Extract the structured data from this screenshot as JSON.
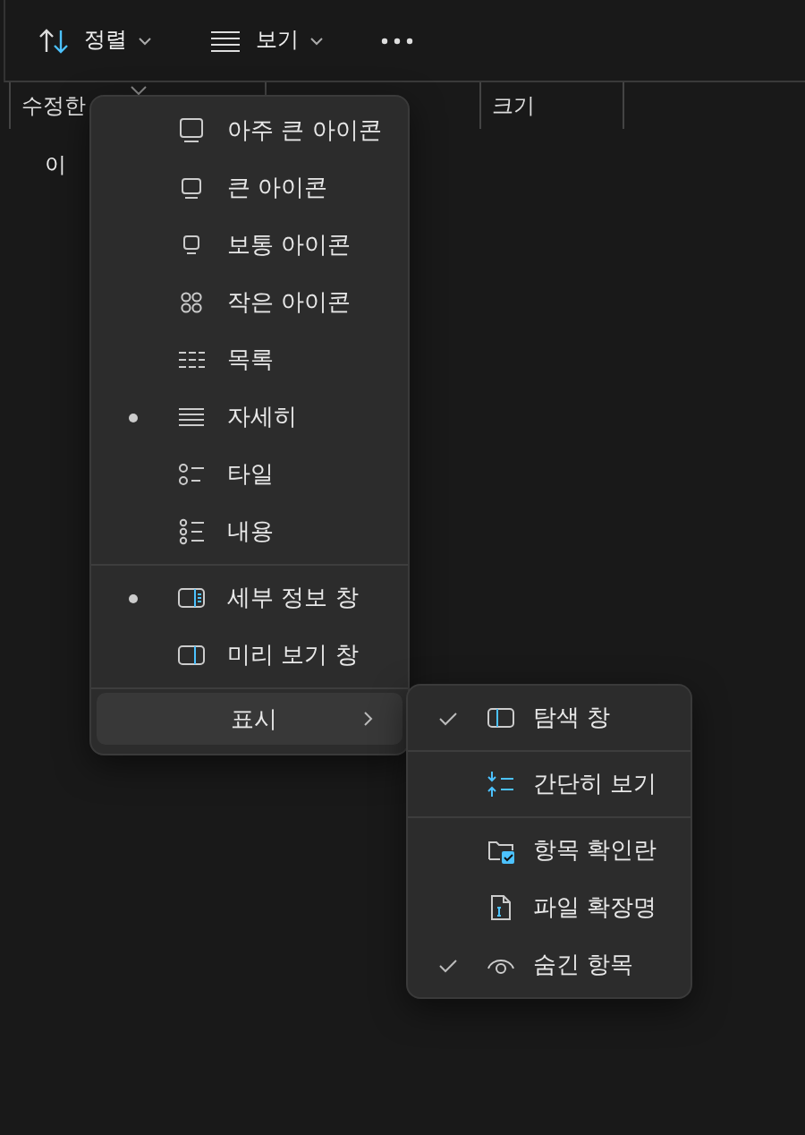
{
  "toolbar": [
    {
      "label": "정렬",
      "kind": "sort"
    },
    {
      "label": "보기",
      "kind": "view"
    },
    {
      "kind": "more"
    }
  ],
  "columns": [
    {
      "label": "수정한"
    },
    {
      "label": "크기"
    }
  ],
  "empty_message": "이",
  "view_menu": {
    "items": [
      {
        "kind": "item",
        "label": "아주 큰 아이콘",
        "selected": false
      },
      {
        "kind": "item",
        "label": "큰 아이콘",
        "selected": false
      },
      {
        "kind": "item",
        "label": "보통 아이콘",
        "selected": false
      },
      {
        "kind": "item",
        "label": "작은 아이콘",
        "selected": false
      },
      {
        "kind": "item",
        "label": "목록",
        "selected": false
      },
      {
        "kind": "item",
        "label": "자세히",
        "selected": true
      },
      {
        "kind": "item",
        "label": "타일",
        "selected": false
      },
      {
        "kind": "item",
        "label": "내용",
        "selected": false
      },
      {
        "kind": "divider"
      },
      {
        "kind": "item",
        "label": "세부 정보 창",
        "selected": true
      },
      {
        "kind": "item",
        "label": "미리 보기 창",
        "selected": false
      },
      {
        "kind": "divider"
      },
      {
        "kind": "submenu",
        "label": "표시",
        "selected": true
      }
    ]
  },
  "show_submenu": {
    "items": [
      {
        "kind": "item",
        "label": "탐색 창",
        "checked": true
      },
      {
        "kind": "divider"
      },
      {
        "kind": "item",
        "label": "간단히 보기",
        "checked": false
      },
      {
        "kind": "divider"
      },
      {
        "kind": "item",
        "label": "항목 확인란",
        "checked": false
      },
      {
        "kind": "item",
        "label": "파일 확장명",
        "checked": false
      },
      {
        "kind": "item",
        "label": "숨긴 항목",
        "checked": true
      }
    ]
  }
}
